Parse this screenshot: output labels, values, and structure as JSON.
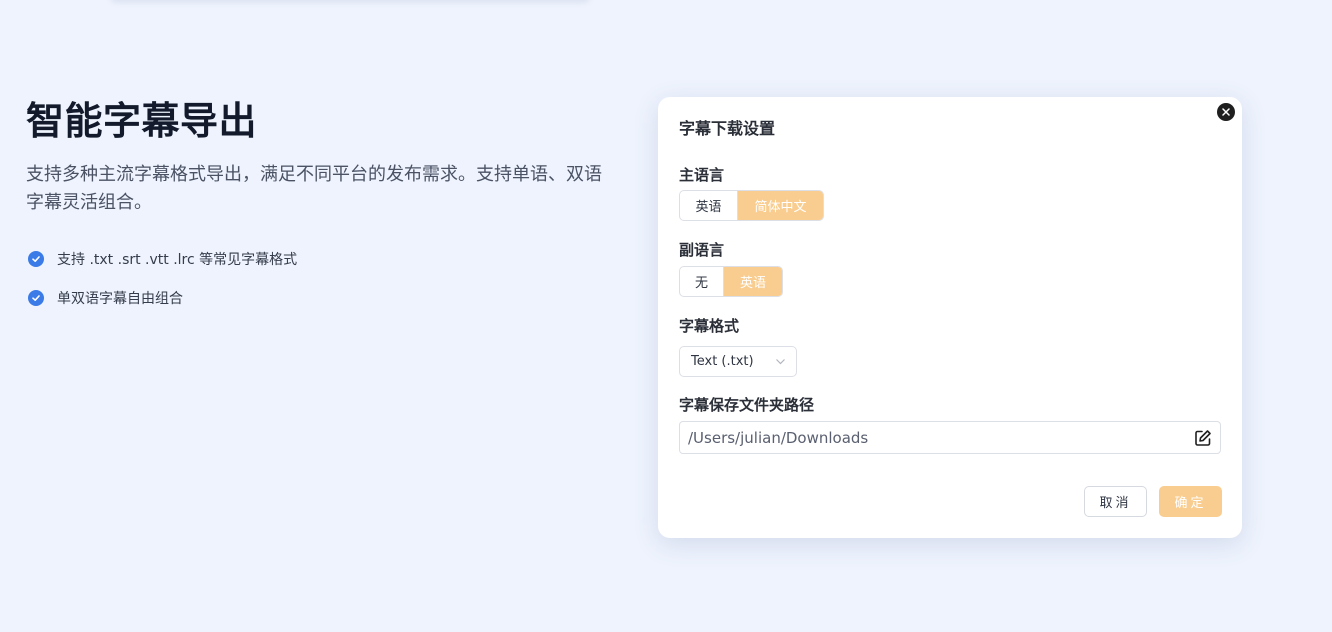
{
  "hero": {
    "title": "智能字幕导出",
    "description": "支持多种主流字幕格式导出，满足不同平台的发布需求。支持单语、双语字幕灵活组合。",
    "features": [
      "支持 .txt .srt .vtt .lrc 等常见字幕格式",
      "单双语字幕自由组合"
    ]
  },
  "dialog": {
    "title": "字幕下载设置",
    "primary_language": {
      "label": "主语言",
      "options": [
        "英语",
        "简体中文"
      ],
      "selected": "简体中文"
    },
    "secondary_language": {
      "label": "副语言",
      "options": [
        "无",
        "英语"
      ],
      "selected": "英语"
    },
    "format": {
      "label": "字幕格式",
      "value": "Text (.txt)"
    },
    "save_path": {
      "label": "字幕保存文件夹路径",
      "value": "/Users/julian/Downloads"
    },
    "cancel_label": "取消",
    "confirm_label": "确定"
  },
  "colors": {
    "accent": "#f9cd8f",
    "check": "#3b7be8",
    "background": "#eef3fd"
  },
  "icons": {
    "close": "close-icon",
    "check": "check-circle-icon",
    "edit": "edit-icon",
    "chevron": "chevron-down-icon"
  }
}
